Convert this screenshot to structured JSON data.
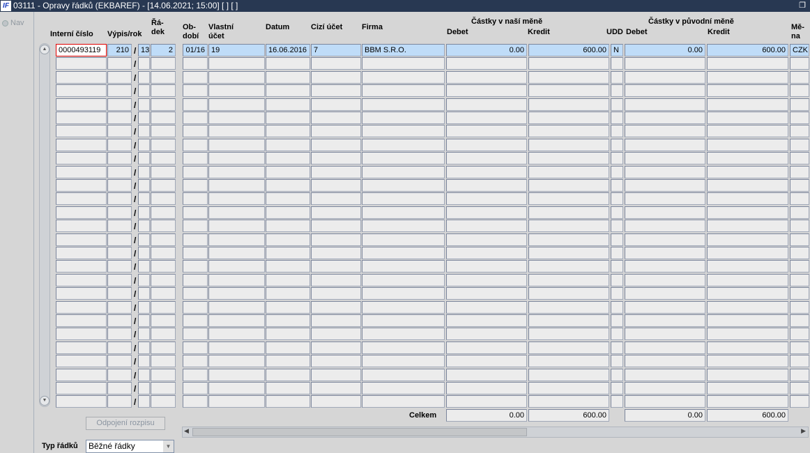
{
  "window": {
    "title": "03111 - Opravy řádků (EKBAREF) - [14.06.2021; 15:00]  [ ]  [ ]",
    "logo": "IF",
    "restore_icon": "restore-icon"
  },
  "nav": {
    "label": "Nav"
  },
  "headers": {
    "interni": "Interní číslo",
    "vypis": "Výpis/rok",
    "radek1": "Řá-",
    "radek2": "dek",
    "obdobi1": "Ob-",
    "obdobi2": "dobí",
    "vlastni1": "Vlastní",
    "vlastni2": "účet",
    "datum": "Datum",
    "cizi": "Cizí účet",
    "firma": "Firma",
    "group_nase": "Částky v naší měně",
    "debet": "Debet",
    "kredit": "Kredit",
    "udd": "UDD",
    "group_puvodni": "Částky v původní měně",
    "debet2": "Debet",
    "kredit2": "Kredit",
    "mena1": "Mě-",
    "mena2": "na"
  },
  "row_count": 27,
  "rows": [
    {
      "interni": "0000493119",
      "vypis": "210",
      "rok": "13",
      "radek": "2",
      "obdobi": "01/16",
      "vlastni": "19",
      "datum": "16.06.2016",
      "cizi": "7",
      "firma": "BBM S.R.O.",
      "debet": "0.00",
      "kredit": "600.00",
      "udd": "N",
      "debet2": "0.00",
      "kredit2": "600.00",
      "mena": "CZK"
    }
  ],
  "totals": {
    "label": "Celkem",
    "debet": "0.00",
    "kredit": "600.00",
    "debet2": "0.00",
    "kredit2": "600.00"
  },
  "buttons": {
    "odpojeni": "Odpojení rozpisu"
  },
  "typ": {
    "label": "Typ řádků",
    "value": "Běžné řádky"
  }
}
